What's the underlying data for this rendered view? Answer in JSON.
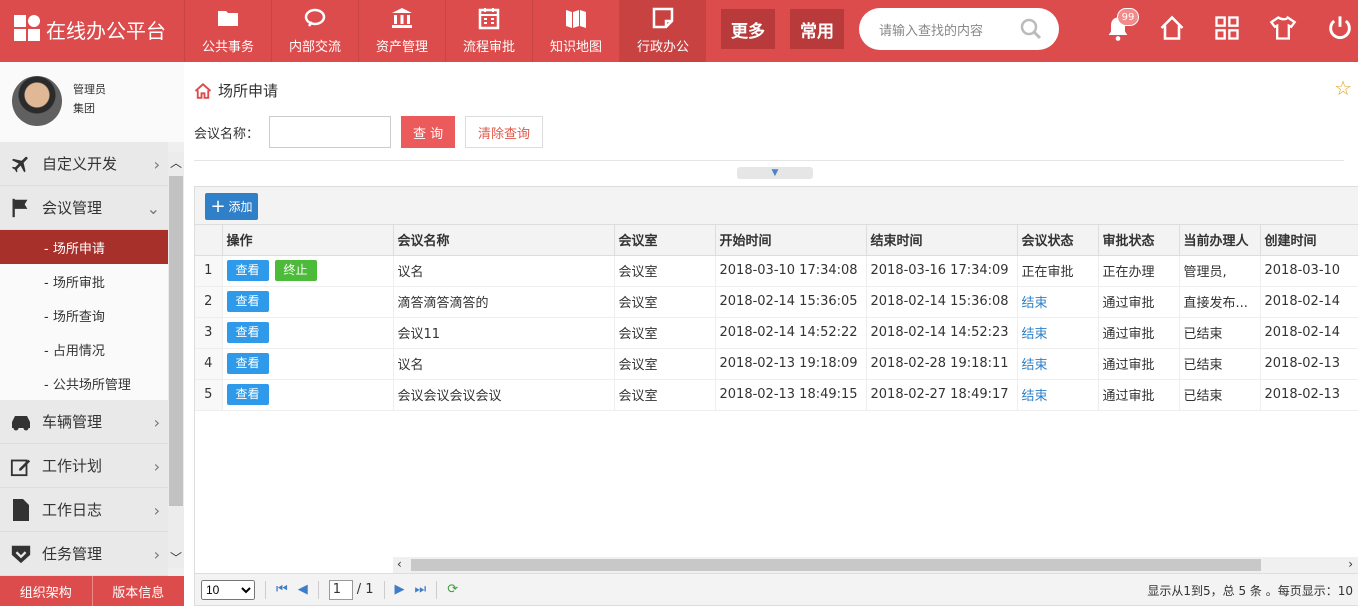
{
  "app": {
    "title": "在线办公平台"
  },
  "nav": [
    {
      "label": "公共事务",
      "icon": "folder-icon"
    },
    {
      "label": "内部交流",
      "icon": "chat-icon"
    },
    {
      "label": "资产管理",
      "icon": "bank-icon"
    },
    {
      "label": "流程审批",
      "icon": "calendar-icon"
    },
    {
      "label": "知识地图",
      "icon": "map-icon"
    },
    {
      "label": "行政办公",
      "icon": "note-icon"
    }
  ],
  "top_buttons": {
    "more": "更多",
    "common": "常用"
  },
  "search": {
    "placeholder": "请输入查找的内容"
  },
  "notifications": {
    "count": "99"
  },
  "profile": {
    "name": "管理员",
    "org": "集团"
  },
  "menu": {
    "custom_dev": "自定义开发",
    "meeting_mgmt": "会议管理",
    "sub": [
      "- 场所申请",
      "- 场所审批",
      "- 场所查询",
      "- 占用情况",
      "- 公共场所管理"
    ],
    "vehicle": "车辆管理",
    "work_plan": "工作计划",
    "work_log": "工作日志",
    "task_mgmt": "任务管理"
  },
  "side_bottom": {
    "org": "组织架构",
    "version": "版本信息"
  },
  "page": {
    "title": "场所申请"
  },
  "filter": {
    "label": "会议名称：",
    "value": "",
    "query": "查 询",
    "clear": "清除查询"
  },
  "toolbar": {
    "add": "添加"
  },
  "table": {
    "columns": [
      "操作",
      "会议名称",
      "会议室",
      "开始时间",
      "结束时间",
      "会议状态",
      "审批状态",
      "当前办理人",
      "创建时间"
    ],
    "view_label": "查看",
    "stop_label": "终止",
    "rows": [
      {
        "no": "1",
        "name": "议名",
        "room": "会议室",
        "start": "2018-03-10 17:34:08",
        "end": "2018-03-16 17:34:09",
        "status": "正在审批",
        "approval": "正在办理",
        "handler": "管理员,",
        "created": "2018-03-10"
      },
      {
        "no": "2",
        "name": "滴答滴答滴答的",
        "room": "会议室",
        "start": "2018-02-14 15:36:05",
        "end": "2018-02-14 15:36:08",
        "status": "结束",
        "approval": "通过审批",
        "handler": "直接发布...",
        "created": "2018-02-14"
      },
      {
        "no": "3",
        "name": "会议11",
        "room": "会议室",
        "start": "2018-02-14 14:52:22",
        "end": "2018-02-14 14:52:23",
        "status": "结束",
        "approval": "通过审批",
        "handler": "已结束",
        "created": "2018-02-14"
      },
      {
        "no": "4",
        "name": "议名",
        "room": "会议室",
        "start": "2018-02-13 19:18:09",
        "end": "2018-02-28 19:18:11",
        "status": "结束",
        "approval": "通过审批",
        "handler": "已结束",
        "created": "2018-02-13"
      },
      {
        "no": "5",
        "name": "会议会议会议会议",
        "room": "会议室",
        "start": "2018-02-13 18:49:15",
        "end": "2018-02-27 18:49:17",
        "status": "结束",
        "approval": "通过审批",
        "handler": "已结束",
        "created": "2018-02-13"
      }
    ]
  },
  "pager": {
    "page_size": "10",
    "current": "1",
    "total": "/ 1",
    "info": "显示从1到5，总 5 条 。每页显示：10"
  }
}
